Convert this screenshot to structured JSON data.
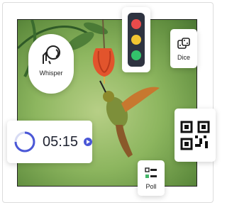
{
  "widgets": {
    "whisper": {
      "label": "Whisper",
      "icon": "whisper-icon"
    },
    "traffic_light": {
      "colors": [
        "#e84b4b",
        "#f2c531",
        "#33c26b"
      ]
    },
    "dice": {
      "label": "Dice",
      "icon": "dice-icon"
    },
    "timer": {
      "time": "05:15",
      "play_icon": "play-icon",
      "progress_icon": "progress-ring-icon"
    },
    "qr": {
      "icon": "qr-code-icon"
    },
    "poll": {
      "label": "Poll",
      "icon": "poll-icon"
    }
  },
  "background": {
    "subject": "hummingbird-photo"
  }
}
